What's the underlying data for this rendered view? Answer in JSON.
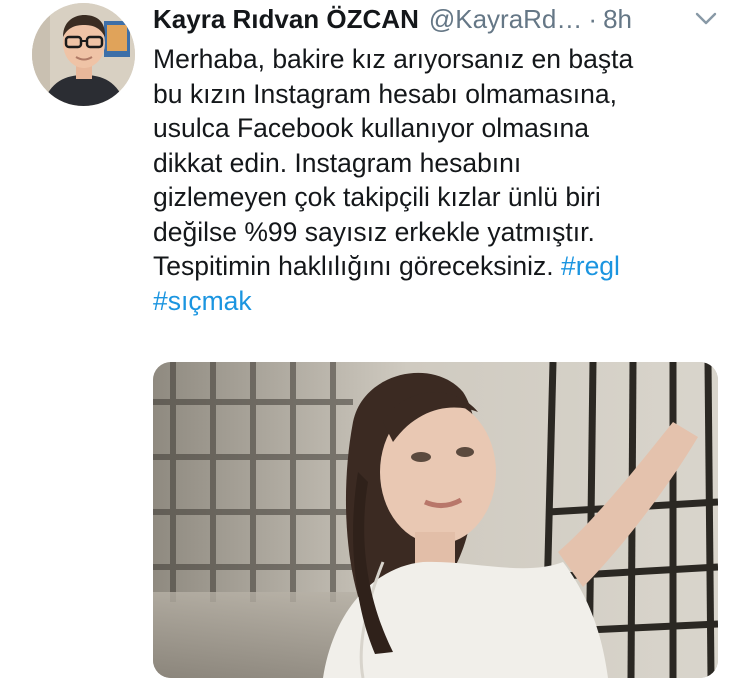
{
  "tweet": {
    "author_name": "Kayra Rıdvan ÖZCAN",
    "handle": "@KayraRd…",
    "separator": "·",
    "time": "8h",
    "text_lines": [
      "Merhaba, bakire kız arıyorsanız en başta",
      "bu kızın Instagram hesabı olmamasına,",
      "usulca Facebook kullanıyor olmasına",
      "dikkat edin. Instagram hesabını",
      "gizlemeyen çok takipçili kızlar ünlü biri",
      "değilse %99 sayısız erkekle yatmıştır.",
      "Tespitimin haklılığını göreceksiniz."
    ],
    "hashtags": [
      "#regl",
      "#sıçmak"
    ]
  },
  "icons": {
    "caret": "chevron-down-icon",
    "avatar": "profile-photo",
    "media": "photo"
  },
  "colors": {
    "name": "#14171a",
    "secondary": "#657786",
    "hashtag": "#1b95e0"
  }
}
